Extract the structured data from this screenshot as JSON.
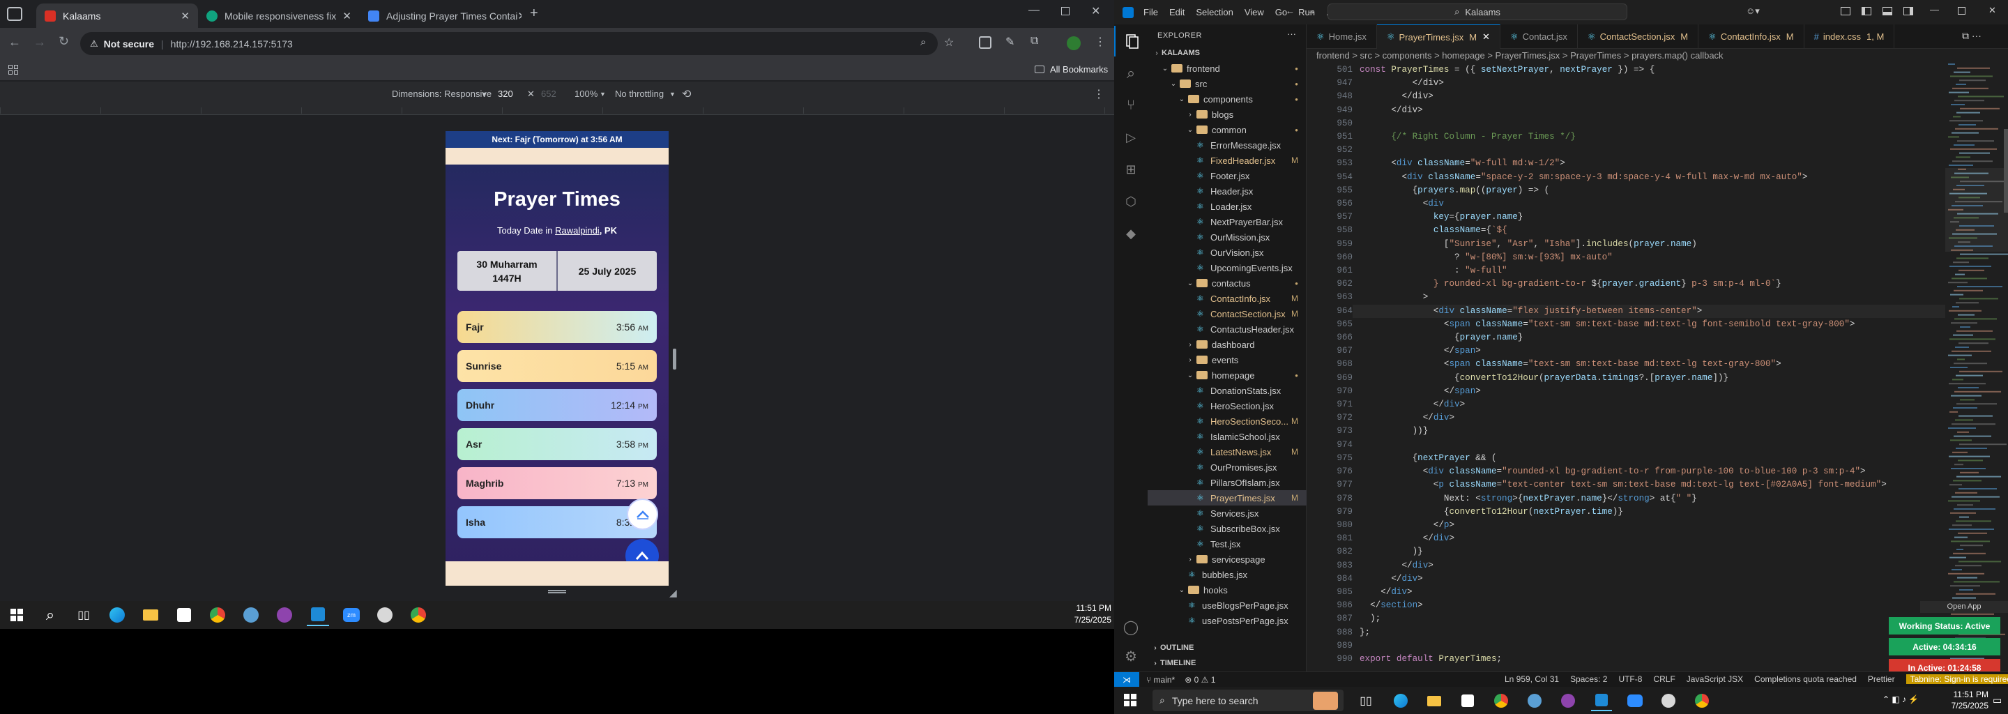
{
  "chrome": {
    "tabs": [
      {
        "title": "Kalaams",
        "active": true,
        "color": "#d93025"
      },
      {
        "title": "Mobile responsiveness fix",
        "active": false,
        "color": "#10a37f"
      },
      {
        "title": "Adjusting Prayer Times Contai",
        "active": false,
        "color": "#4285f4"
      }
    ],
    "not_secure": "Not secure",
    "url": "http://192.168.214.157:5173",
    "all_bookmarks": "All Bookmarks",
    "devtools": {
      "dimensions": "Dimensions: Responsive",
      "width": "320",
      "height": "652",
      "zoom": "100%",
      "throttle": "No throttling"
    }
  },
  "app": {
    "next_banner": "Next: Fajr (Tomorrow) at 3:56 AM",
    "title": "Prayer Times",
    "today_prefix": "Today Date in",
    "city": "Rawalpindi",
    "country": ", PK",
    "hijri_line1": "30 Muharram",
    "hijri_line2": "1447H",
    "gregorian": "25 July 2025",
    "prayers": [
      {
        "name": "Fajr",
        "time": "3:56",
        "ampm": "AM"
      },
      {
        "name": "Sunrise",
        "time": "5:15",
        "ampm": "AM"
      },
      {
        "name": "Dhuhr",
        "time": "12:14",
        "ampm": "PM"
      },
      {
        "name": "Asr",
        "time": "3:58",
        "ampm": "PM"
      },
      {
        "name": "Maghrib",
        "time": "7:13",
        "ampm": "PM"
      },
      {
        "name": "Isha",
        "time": "8:32",
        "ampm": "PM"
      }
    ]
  },
  "taskbar_left": {
    "time": "11:51 PM",
    "date": "7/25/2025"
  },
  "vscode": {
    "menu": [
      "File",
      "Edit",
      "Selection",
      "View",
      "Go",
      "Run",
      "..."
    ],
    "search": "Kalaams",
    "explorer_title": "EXPLORER",
    "tree": [
      {
        "label": "KALAAMS",
        "type": "root",
        "indent": 0
      },
      {
        "label": "frontend",
        "type": "folder",
        "indent": 1,
        "open": true,
        "badge": "dot"
      },
      {
        "label": "src",
        "type": "folder",
        "indent": 2,
        "open": true,
        "badge": "dot"
      },
      {
        "label": "components",
        "type": "folder",
        "indent": 3,
        "open": true,
        "badge": "dot"
      },
      {
        "label": "blogs",
        "type": "folder",
        "indent": 4,
        "open": false
      },
      {
        "label": "common",
        "type": "folder",
        "indent": 4,
        "open": true,
        "badge": "dot"
      },
      {
        "label": "ErrorMessage.jsx",
        "type": "file",
        "indent": 5
      },
      {
        "label": "FixedHeader.jsx",
        "type": "file",
        "indent": 5,
        "badge": "M"
      },
      {
        "label": "Footer.jsx",
        "type": "file",
        "indent": 5
      },
      {
        "label": "Header.jsx",
        "type": "file",
        "indent": 5
      },
      {
        "label": "Loader.jsx",
        "type": "file",
        "indent": 5
      },
      {
        "label": "NextPrayerBar.jsx",
        "type": "file",
        "indent": 5
      },
      {
        "label": "OurMission.jsx",
        "type": "file",
        "indent": 5
      },
      {
        "label": "OurVision.jsx",
        "type": "file",
        "indent": 5
      },
      {
        "label": "UpcomingEvents.jsx",
        "type": "file",
        "indent": 5
      },
      {
        "label": "contactus",
        "type": "folder",
        "indent": 4,
        "open": true,
        "badge": "dot"
      },
      {
        "label": "ContactInfo.jsx",
        "type": "file",
        "indent": 5,
        "badge": "M"
      },
      {
        "label": "ContactSection.jsx",
        "type": "file",
        "indent": 5,
        "badge": "M"
      },
      {
        "label": "ContactusHeader.jsx",
        "type": "file",
        "indent": 5
      },
      {
        "label": "dashboard",
        "type": "folder",
        "indent": 4,
        "open": false
      },
      {
        "label": "events",
        "type": "folder",
        "indent": 4,
        "open": false
      },
      {
        "label": "homepage",
        "type": "folder",
        "indent": 4,
        "open": true,
        "badge": "dot"
      },
      {
        "label": "DonationStats.jsx",
        "type": "file",
        "indent": 5
      },
      {
        "label": "HeroSection.jsx",
        "type": "file",
        "indent": 5
      },
      {
        "label": "HeroSectionSeco...",
        "type": "file",
        "indent": 5,
        "badge": "M"
      },
      {
        "label": "IslamicSchool.jsx",
        "type": "file",
        "indent": 5
      },
      {
        "label": "LatestNews.jsx",
        "type": "file",
        "indent": 5,
        "badge": "M"
      },
      {
        "label": "OurPromises.jsx",
        "type": "file",
        "indent": 5
      },
      {
        "label": "PillarsOfIslam.jsx",
        "type": "file",
        "indent": 5
      },
      {
        "label": "PrayerTimes.jsx",
        "type": "file",
        "indent": 5,
        "badge": "M",
        "selected": true
      },
      {
        "label": "Services.jsx",
        "type": "file",
        "indent": 5
      },
      {
        "label": "SubscribeBox.jsx",
        "type": "file",
        "indent": 5
      },
      {
        "label": "Test.jsx",
        "type": "file",
        "indent": 5
      },
      {
        "label": "servicespage",
        "type": "folder",
        "indent": 4,
        "open": false
      },
      {
        "label": "bubbles.jsx",
        "type": "file",
        "indent": 4
      },
      {
        "label": "hooks",
        "type": "folder",
        "indent": 3,
        "open": true
      },
      {
        "label": "useBlogsPerPage.jsx",
        "type": "file",
        "indent": 4
      },
      {
        "label": "usePostsPerPage.jsx",
        "type": "file",
        "indent": 4
      }
    ],
    "outline": "OUTLINE",
    "timeline": "TIMELINE",
    "editor_tabs": [
      {
        "label": "Home.jsx",
        "m": ""
      },
      {
        "label": "PrayerTimes.jsx",
        "m": "M",
        "active": true
      },
      {
        "label": "Contact.jsx",
        "m": ""
      },
      {
        "label": "ContactSection.jsx",
        "m": "M"
      },
      {
        "label": "ContactInfo.jsx",
        "m": "M"
      },
      {
        "label": "index.css",
        "m": "1, M"
      }
    ],
    "breadcrumb": "frontend > src > components > homepage > PrayerTimes.jsx > PrayerTimes > prayers.map() callback",
    "line_numbers": [
      "501",
      "947",
      "948",
      "949",
      "950",
      "951",
      "952",
      "953",
      "954",
      "955",
      "956",
      "957",
      "958",
      "959",
      "960",
      "961",
      "962",
      "963",
      "964",
      "965",
      "966",
      "967",
      "968",
      "969",
      "970",
      "971",
      "972",
      "973",
      "974",
      "975",
      "976",
      "977",
      "978",
      "979",
      "980",
      "981",
      "982",
      "983",
      "984",
      "985",
      "986",
      "987",
      "988",
      "989",
      "990"
    ],
    "code_lines": [
      "<span class=\"kw\">const</span> <span class=\"fn\">PrayerTimes</span> = ({ <span class=\"at\">setNextPrayer</span>, <span class=\"at\">nextPrayer</span> }) => {",
      "          &lt;/div&gt;",
      "        &lt;/div&gt;",
      "      &lt;/div&gt;",
      "",
      "      <span class=\"cm\">{/* Right Column - Prayer Times */}</span>",
      "",
      "      &lt;<span class=\"tg\">div</span> <span class=\"at\">className</span>=<span class=\"st\">\"w-full md:w-1/2\"</span>&gt;",
      "        &lt;<span class=\"tg\">div</span> <span class=\"at\">className</span>=<span class=\"st\">\"space-y-2 sm:space-y-3 md:space-y-4 w-full max-w-md mx-auto\"</span>&gt;",
      "          {<span class=\"at\">prayers</span>.<span class=\"fn\">map</span>((<span class=\"at\">prayer</span>) => (",
      "            &lt;<span class=\"tg\">div</span>",
      "              <span class=\"at\">key</span>={<span class=\"at\">prayer</span>.<span class=\"at\">name</span>}",
      "              <span class=\"at\">className</span>={<span class=\"st\">`${</span>",
      "                [<span class=\"st\">\"Sunrise\"</span>, <span class=\"st\">\"Asr\"</span>, <span class=\"st\">\"Isha\"</span>].<span class=\"fn\">includes</span>(<span class=\"at\">prayer</span>.<span class=\"at\">name</span>)",
      "                  ? <span class=\"st\">\"w-[80%] sm:w-[93%] mx-auto\"</span>",
      "                  : <span class=\"st\">\"w-full\"</span>",
      "              <span class=\"st\">} rounded-xl bg-gradient-to-r </span>${<span class=\"at\">prayer</span>.<span class=\"at\">gradient</span>}<span class=\"st\"> p-3 sm:p-4 ml-0`</span>}",
      "            &gt;",
      "              &lt;<span class=\"tg\">div</span> <span class=\"at\">className</span>=<span class=\"st\">\"flex justify-between items-center\"</span>&gt;",
      "                &lt;<span class=\"tg\">span</span> <span class=\"at\">className</span>=<span class=\"st\">\"text-sm sm:text-base md:text-lg font-semibold text-gray-800\"</span>&gt;",
      "                  {<span class=\"at\">prayer</span>.<span class=\"at\">name</span>}",
      "                &lt;/<span class=\"tg\">span</span>&gt;",
      "                &lt;<span class=\"tg\">span</span> <span class=\"at\">className</span>=<span class=\"st\">\"text-sm sm:text-base md:text-lg text-gray-800\"</span>&gt;",
      "                  {<span class=\"fn\">convertTo12Hour</span>(<span class=\"at\">prayerData</span>.<span class=\"at\">timings</span>?.[<span class=\"at\">prayer</span>.<span class=\"at\">name</span>])}",
      "                &lt;/<span class=\"tg\">span</span>&gt;",
      "              &lt;/<span class=\"tg\">div</span>&gt;",
      "            &lt;/<span class=\"tg\">div</span>&gt;",
      "          ))}",
      "",
      "          {<span class=\"at\">nextPrayer</span> &amp;&amp; (",
      "            &lt;<span class=\"tg\">div</span> <span class=\"at\">className</span>=<span class=\"st\">\"rounded-xl bg-gradient-to-r from-purple-100 to-blue-100 p-3 sm:p-4\"</span>&gt;",
      "              &lt;<span class=\"tg\">p</span> <span class=\"at\">className</span>=<span class=\"st\">\"text-center text-sm sm:text-base md:text-lg text-[#02A0A5] font-medium\"</span>&gt;",
      "                Next: &lt;<span class=\"tg\">strong</span>&gt;{<span class=\"at\">nextPrayer</span>.<span class=\"at\">name</span>}&lt;/<span class=\"tg\">strong</span>&gt; at{<span class=\"st\">\" \"</span>}",
      "                {<span class=\"fn\">convertTo12Hour</span>(<span class=\"at\">nextPrayer</span>.<span class=\"at\">time</span>)}",
      "              &lt;/<span class=\"tg\">p</span>&gt;",
      "            &lt;/<span class=\"tg\">div</span>&gt;",
      "          )}",
      "        &lt;/<span class=\"tg\">div</span>&gt;",
      "      &lt;/<span class=\"tg\">div</span>&gt;",
      "    &lt;/<span class=\"tg\">div</span>&gt;",
      "  &lt;/<span class=\"tg\">section</span>&gt;",
      "  );",
      "};",
      "",
      "<span class=\"kw\">export default</span> <span class=\"fn\">PrayerTimes</span>;"
    ],
    "status": {
      "branch": "main*",
      "problems": "⊗ 0 ⚠ 1",
      "position": "Ln 959, Col 31",
      "spaces": "Spaces: 2",
      "encoding": "UTF-8",
      "eol": "CRLF",
      "language": "JavaScript JSX",
      "completions": "Completions quota reached",
      "prettier": "Prettier",
      "tabnine": "Tabnine: Sign-in is required"
    },
    "open_app": "Open App",
    "working_status": "Working Status: Active",
    "active_time": "Active: 04:34:16",
    "inactive_time": "In Active: 01:24:58"
  },
  "taskbar_right": {
    "search_placeholder": "Type here to search",
    "time": "11:51 PM",
    "date": "7/25/2025"
  },
  "colors": {
    "fajr": "#f7d98f",
    "sunrise": "#fde3a7",
    "dhuhr": "#8ec5f5",
    "asr": "#b8f0d0",
    "maghrib": "#f8b4c8",
    "isha": "#93c5fd",
    "vscode_blue": "#0078d4"
  }
}
